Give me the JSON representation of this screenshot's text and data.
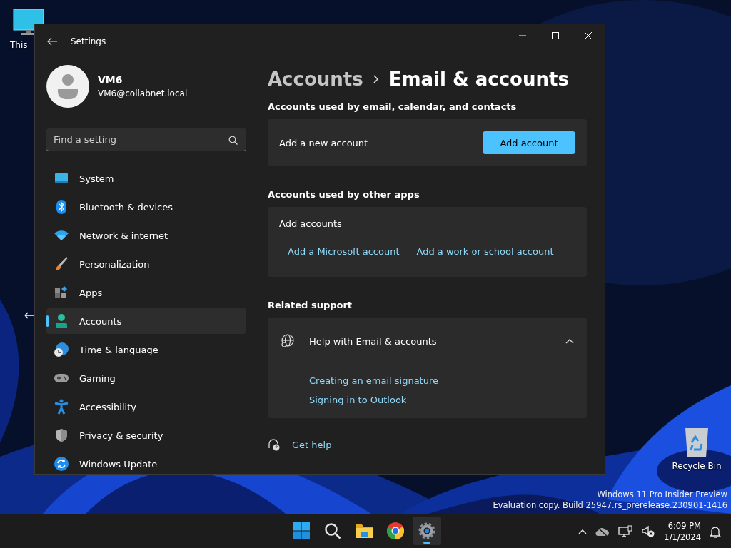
{
  "desktop_icons": [
    {
      "kind": "pc",
      "label": "This"
    },
    {
      "kind": "bin",
      "label": "Recycle Bin"
    }
  ],
  "window": {
    "title": "Settings"
  },
  "user": {
    "name": "VM6",
    "email": "VM6@collabnet.local"
  },
  "search": {
    "placeholder": "Find a setting"
  },
  "nav": [
    {
      "kind": "system",
      "label": "System",
      "selected": false
    },
    {
      "kind": "bluetooth",
      "label": "Bluetooth & devices",
      "selected": false
    },
    {
      "kind": "network",
      "label": "Network & internet",
      "selected": false
    },
    {
      "kind": "brush",
      "label": "Personalization",
      "selected": false
    },
    {
      "kind": "apps",
      "label": "Apps",
      "selected": false
    },
    {
      "kind": "person",
      "label": "Accounts",
      "selected": true
    },
    {
      "kind": "time",
      "label": "Time & language",
      "selected": false
    },
    {
      "kind": "gaming",
      "label": "Gaming",
      "selected": false
    },
    {
      "kind": "accessibility",
      "label": "Accessibility",
      "selected": false
    },
    {
      "kind": "shield",
      "label": "Privacy & security",
      "selected": false
    },
    {
      "kind": "update",
      "label": "Windows Update",
      "selected": false
    }
  ],
  "breadcrumb": {
    "parent": "Accounts",
    "current": "Email & accounts"
  },
  "email_section": {
    "heading": "Accounts used by email, calendar, and contacts",
    "row_label": "Add a new account",
    "button": "Add account"
  },
  "other_apps_section": {
    "heading": "Accounts used by other apps",
    "title": "Add accounts",
    "links": [
      "Add a Microsoft account",
      "Add a work or school account"
    ]
  },
  "related_support": {
    "heading": "Related support",
    "title": "Help with Email & accounts",
    "expanded": true,
    "links": [
      "Creating an email signature",
      "Signing in to Outlook"
    ]
  },
  "get_help": "Get help",
  "build_info": [
    "Windows 11 Pro Insider Preview",
    "Evaluation copy. Build 25947.rs_prerelease.230901-1416"
  ],
  "taskbar": {
    "apps": [
      {
        "kind": "start",
        "selected": false
      },
      {
        "kind": "search",
        "selected": false
      },
      {
        "kind": "explorer",
        "selected": false
      },
      {
        "kind": "chrome",
        "selected": false
      },
      {
        "kind": "settings",
        "selected": true
      }
    ],
    "time": "6:09 PM",
    "date": "1/1/2024"
  }
}
